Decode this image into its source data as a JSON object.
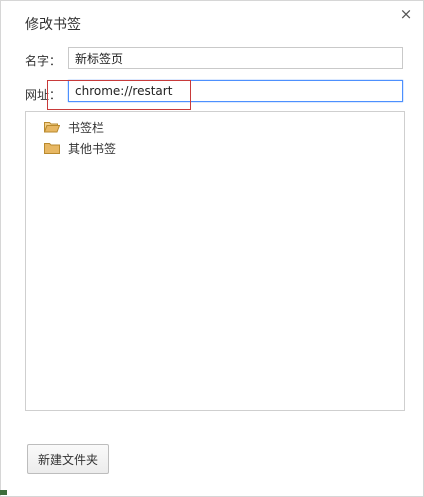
{
  "dialog": {
    "title": "修改书签",
    "close_label": "×"
  },
  "form": {
    "name_label": "名字：",
    "name_value": "新标签页",
    "url_label": "网址：",
    "url_value": "chrome://restart"
  },
  "tree": {
    "items": [
      {
        "label": "书签栏"
      },
      {
        "label": "其他书签"
      }
    ]
  },
  "footer": {
    "new_folder_label": "新建文件夹"
  },
  "colors": {
    "annotation": "#c83a3a",
    "focus": "#4d90fe",
    "folder": "#e7b763"
  }
}
